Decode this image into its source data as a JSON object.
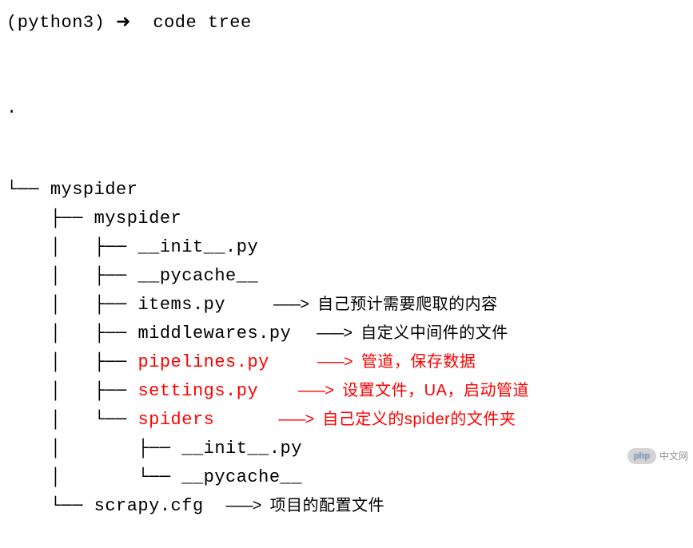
{
  "prompt": {
    "env": "(python3)",
    "arrow": "➜",
    "dir": "code",
    "cmd": "tree"
  },
  "root_dot": ".",
  "tree": [
    {
      "prefix": "└── ",
      "name": "myspider",
      "highlight": false,
      "annot": null
    },
    {
      "prefix": "    ├── ",
      "name": "myspider",
      "highlight": false,
      "annot": null
    },
    {
      "prefix": "    │   ├── ",
      "name": "__init__.py",
      "highlight": false,
      "annot": null
    },
    {
      "prefix": "    │   ├── ",
      "name": "__pycache__",
      "highlight": false,
      "annot": null
    },
    {
      "prefix": "    │   ├── ",
      "name": "items.py",
      "highlight": false,
      "annot": {
        "text": "自己预计需要爬取的内容",
        "highlight": false,
        "pad": 60,
        "arrow": "———>"
      }
    },
    {
      "prefix": "    │   ├── ",
      "name": "middlewares.py",
      "highlight": false,
      "annot": {
        "text": "自定义中间件的文件",
        "highlight": false,
        "pad": 32,
        "arrow": "———>"
      }
    },
    {
      "prefix": "    │   ├── ",
      "name": "pipelines.py",
      "highlight": true,
      "annot": {
        "text": "管道，保存数据",
        "highlight": true,
        "pad": 60,
        "arrow": "———>"
      }
    },
    {
      "prefix": "    │   ├── ",
      "name": "settings.py",
      "highlight": true,
      "annot": {
        "text": "设置文件，UA，启动管道",
        "highlight": true,
        "pad": 50,
        "arrow": "———>"
      }
    },
    {
      "prefix": "    │   └── ",
      "name": "spiders",
      "highlight": true,
      "annot": {
        "text": "自己定义的spider的文件夹",
        "highlight": true,
        "pad": 80,
        "arrow": "———>"
      }
    },
    {
      "prefix": "    │       ├── ",
      "name": "__init__.py",
      "highlight": false,
      "annot": null
    },
    {
      "prefix": "    │       └── ",
      "name": "__pycache__",
      "highlight": false,
      "annot": null
    },
    {
      "prefix": "    └── ",
      "name": "scrapy.cfg",
      "highlight": false,
      "annot": {
        "text": "项目的配置文件",
        "highlight": false,
        "pad": 28,
        "arrow": "———>"
      }
    }
  ],
  "watermark": {
    "badge_p1": "php",
    "badge_p2": "",
    "text": "中文网"
  }
}
